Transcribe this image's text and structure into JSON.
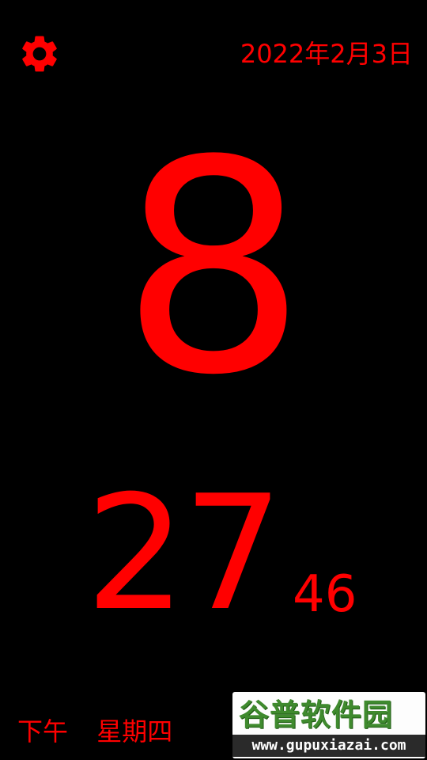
{
  "colors": {
    "background": "#000000",
    "foreground": "#ff0000",
    "watermark_green": "#3f8a2e"
  },
  "toolbar": {
    "settings_icon": "gear-icon"
  },
  "date": {
    "text": "2022年2月3日"
  },
  "clock": {
    "hour": "8",
    "minute": "27",
    "second": "46"
  },
  "footer": {
    "period": "下午",
    "weekday": "星期四"
  },
  "watermark": {
    "brand": "谷普软件园",
    "url": "www.gupuxiazai.com"
  }
}
